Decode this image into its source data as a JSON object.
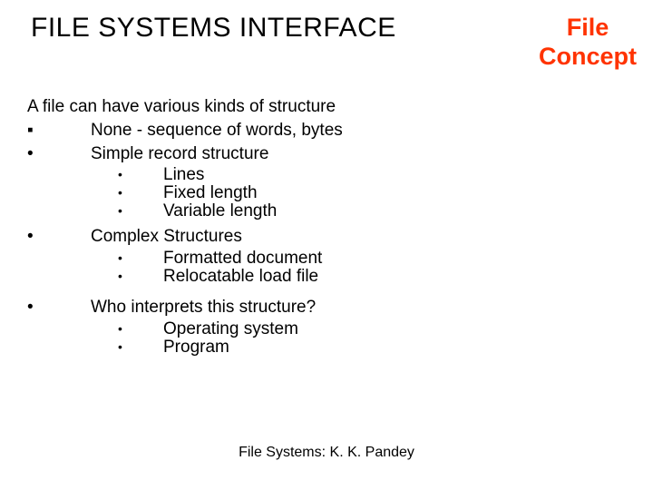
{
  "title": "FILE SYSTEMS INTERFACE",
  "subtitle_line1": "File",
  "subtitle_line2": "Concept",
  "intro": "A file can have various kinds of structure",
  "bullets": {
    "b1_mark": "▪",
    "b1_text": "None - sequence of words, bytes",
    "b2_mark": "•",
    "b2_text": "Simple record structure",
    "b2_sub": [
      {
        "mark": "•",
        "text": "Lines"
      },
      {
        "mark": "•",
        "text": "Fixed length"
      },
      {
        "mark": "•",
        "text": "Variable length"
      }
    ],
    "b3_mark": "•",
    "b3_text": "Complex Structures",
    "b3_sub": [
      {
        "mark": "•",
        "text": "Formatted document"
      },
      {
        "mark": "•",
        "text": "Relocatable load file"
      }
    ],
    "b4_mark": "•",
    "b4_text": "Who interprets this structure?",
    "b4_sub": [
      {
        "mark": "•",
        "text": "Operating system"
      },
      {
        "mark": "•",
        "text": "Program"
      }
    ]
  },
  "footer": "File Systems: K. K. Pandey"
}
